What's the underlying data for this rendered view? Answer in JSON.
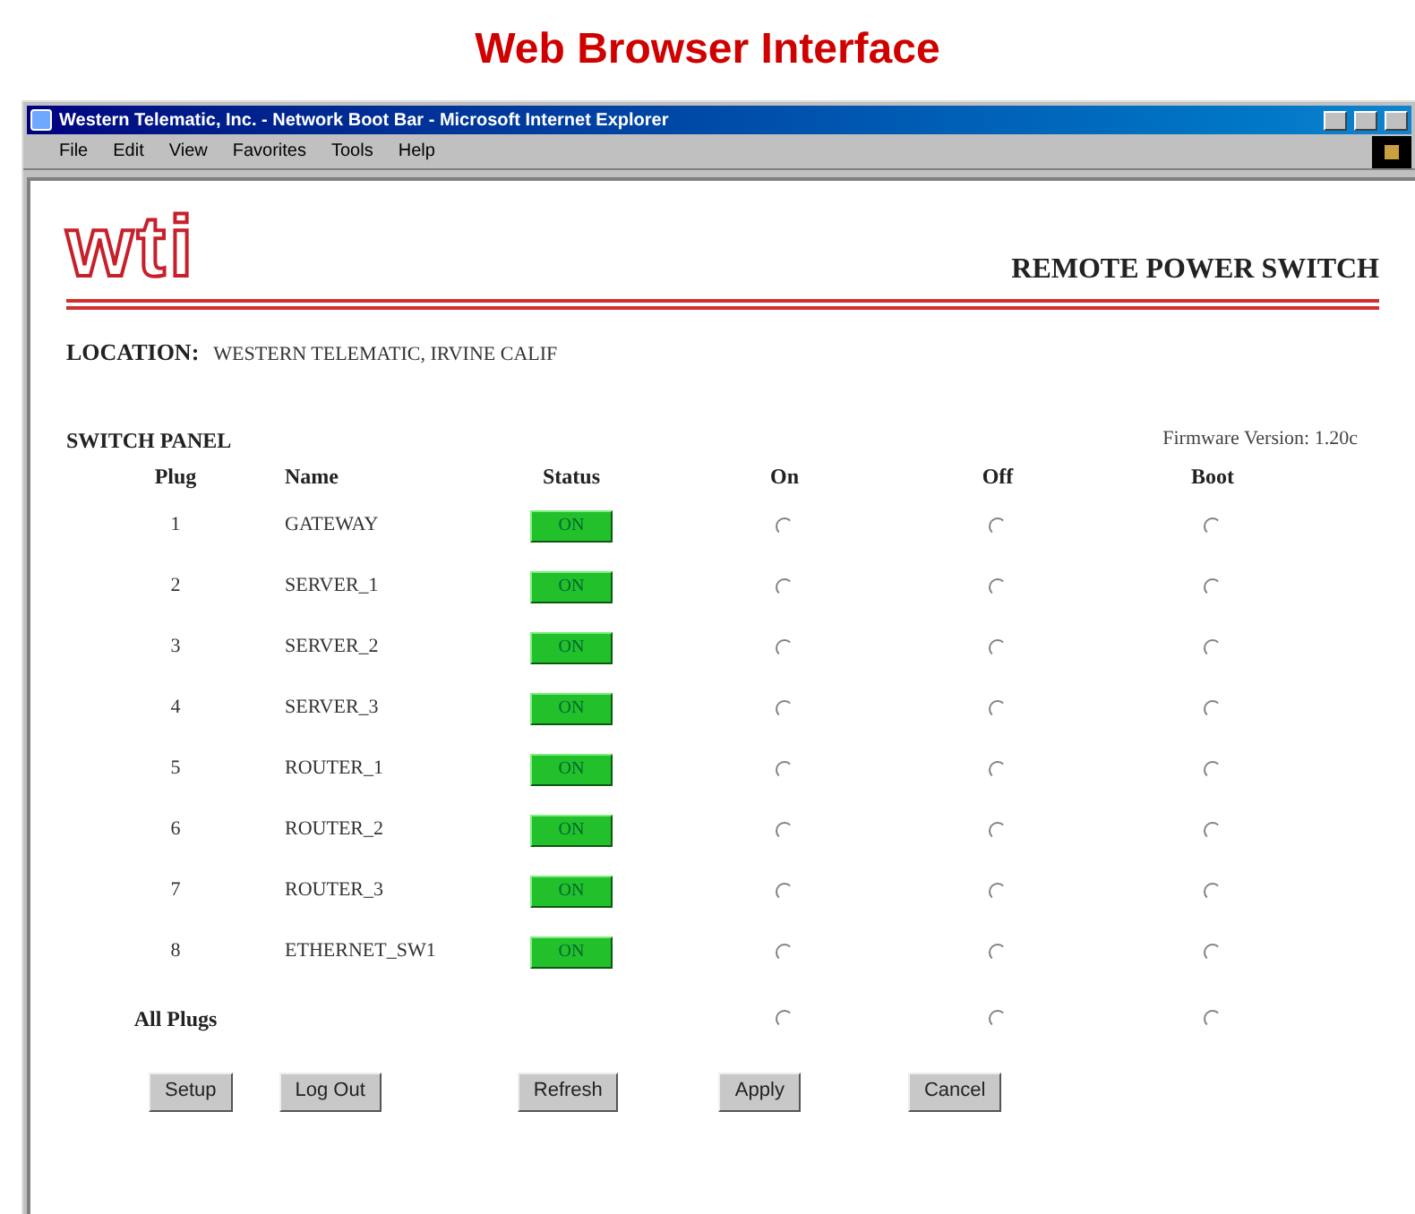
{
  "heading": "Web Browser Interface",
  "window": {
    "title": "Western Telematic, Inc. - Network Boot Bar - Microsoft Internet Explorer"
  },
  "menu": [
    "File",
    "Edit",
    "View",
    "Favorites",
    "Tools",
    "Help"
  ],
  "logo": "wti",
  "product": "REMOTE POWER SWITCH",
  "location": {
    "label": "LOCATION:",
    "value": "WESTERN TELEMATIC, IRVINE CALIF"
  },
  "panel_title": "SWITCH PANEL",
  "firmware": "Firmware Version: 1.20c",
  "columns": [
    "Plug",
    "Name",
    "Status",
    "On",
    "Off",
    "Boot"
  ],
  "rows": [
    {
      "plug": "1",
      "name": "GATEWAY",
      "status": "ON",
      "on": false,
      "off": false,
      "boot": false
    },
    {
      "plug": "2",
      "name": "SERVER_1",
      "status": "ON",
      "on": false,
      "off": false,
      "boot": false
    },
    {
      "plug": "3",
      "name": "SERVER_2",
      "status": "ON",
      "on": false,
      "off": false,
      "boot": false
    },
    {
      "plug": "4",
      "name": "SERVER_3",
      "status": "ON",
      "on": false,
      "off": false,
      "boot": false
    },
    {
      "plug": "5",
      "name": "ROUTER_1",
      "status": "ON",
      "on": false,
      "off": false,
      "boot": false
    },
    {
      "plug": "6",
      "name": "ROUTER_2",
      "status": "ON",
      "on": false,
      "off": false,
      "boot": false
    },
    {
      "plug": "7",
      "name": "ROUTER_3",
      "status": "ON",
      "on": false,
      "off": false,
      "boot": false
    },
    {
      "plug": "8",
      "name": "ETHERNET_SW1",
      "status": "ON",
      "on": false,
      "off": false,
      "boot": false
    }
  ],
  "all_plugs": {
    "label": "All Plugs",
    "on": false,
    "off": false,
    "boot": false
  },
  "buttons": [
    "Setup",
    "Log Out",
    "Refresh",
    "Apply",
    "Cancel"
  ]
}
